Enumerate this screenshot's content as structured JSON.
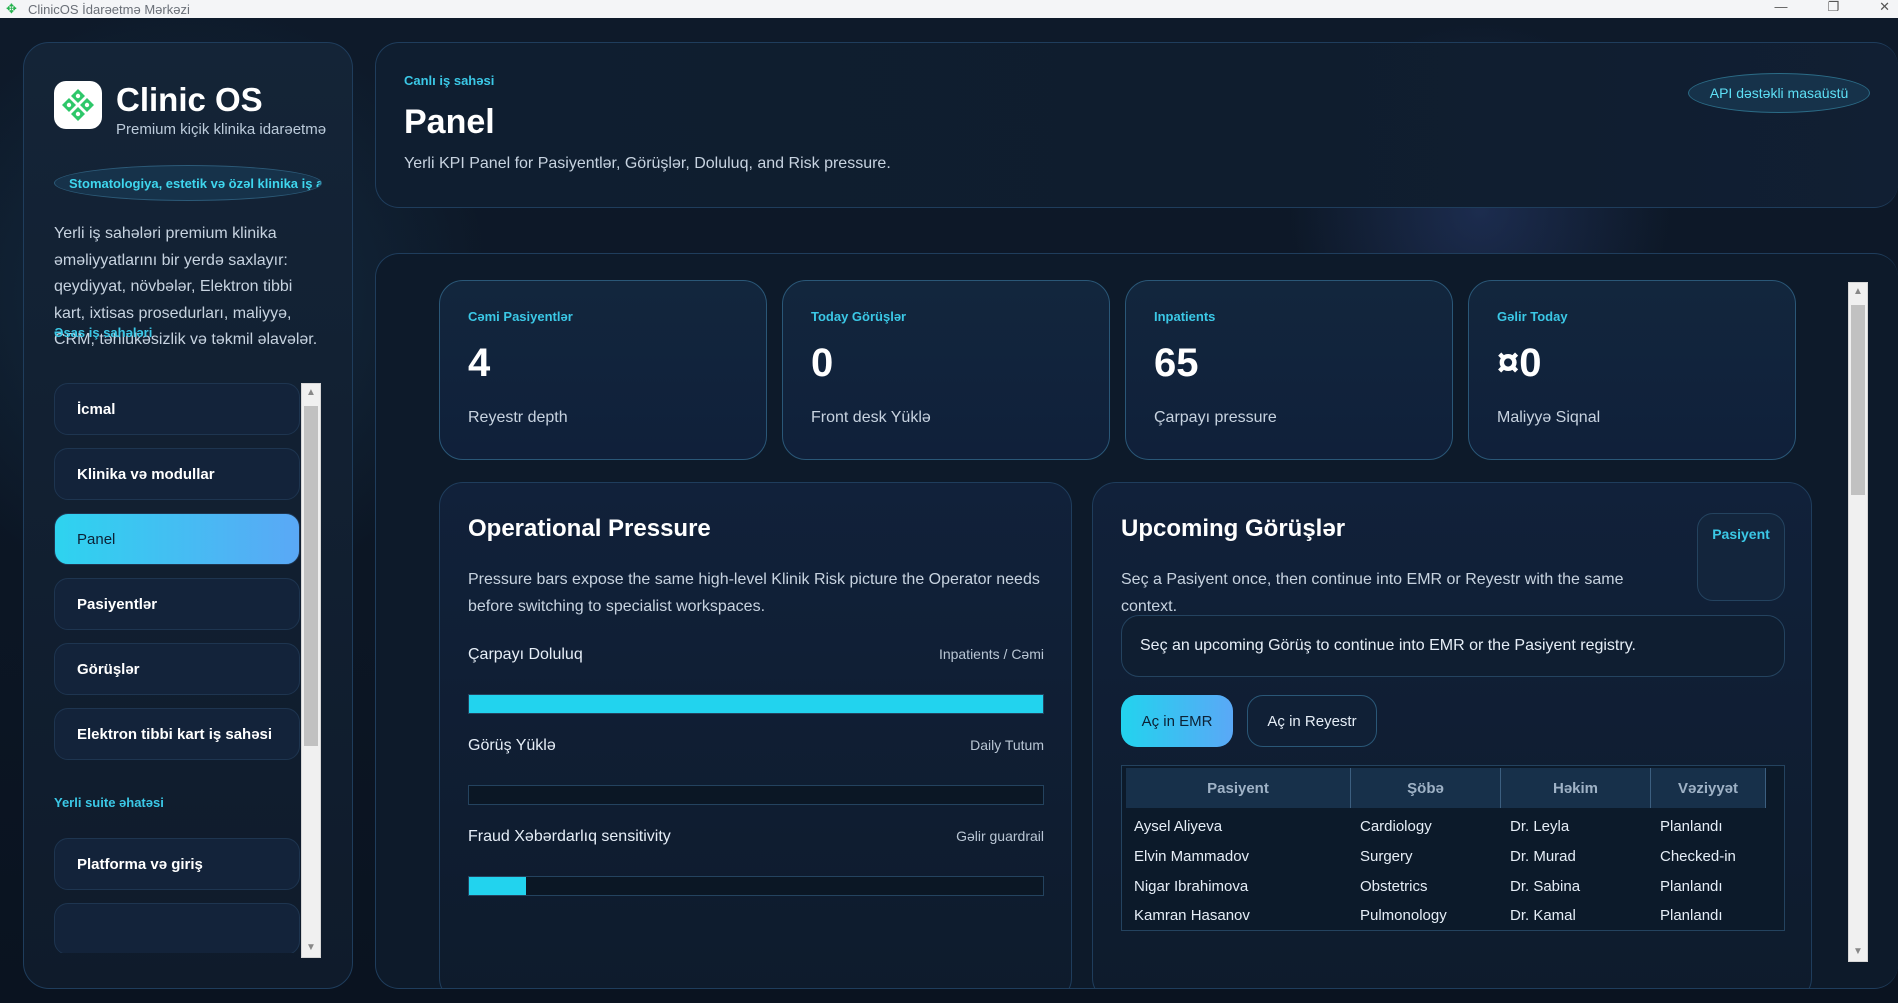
{
  "window": {
    "title": "ClinicOS İdarəetmə Mərkəzi"
  },
  "sidebar": {
    "brand_title": "Clinic OS",
    "brand_subtitle": "Premium kiçik klinika idarəetmə",
    "tag": "Stomatologiya, estetik və özəl klinika iş axını",
    "description": "Yerli iş sahələri premium klinika əməliyyatlarını bir yerdə saxlayır: qeydiyyat, növbələr, Elektron tibbi kart, ixtisas prosedurları, maliyyə, CRM, təhlükəsizlik və təkmil əlavələr.",
    "section_main": "Əsas iş sahələri",
    "section_suite": "Yerli suite əhatəsi",
    "items": [
      {
        "label": "İcmal"
      },
      {
        "label": "Klinika və modullar"
      },
      {
        "label": "Panel",
        "active": true
      },
      {
        "label": "Pasiyentlər"
      },
      {
        "label": "Görüşlər"
      },
      {
        "label": "Elektron tibbi kart iş sahəsi"
      }
    ],
    "suite_items": [
      {
        "label": "Platforma və giriş"
      }
    ]
  },
  "header": {
    "eyebrow": "Canlı iş sahəsi",
    "title": "Panel",
    "subtitle": "Yerli KPI Panel for Pasiyentlər, Görüşlər, Doluluq, and Risk pressure.",
    "api_badge": "API dəstəkli masaüstü"
  },
  "kpis": [
    {
      "label": "Cəmi Pasiyentlər",
      "value": "4",
      "hint": "Reyestr depth"
    },
    {
      "label": "Today Görüşlər",
      "value": "0",
      "hint": "Front desk Yüklə"
    },
    {
      "label": "Inpatients",
      "value": "65",
      "hint": "Çarpayı pressure"
    },
    {
      "label": "Gəlir Today",
      "value": "¤0",
      "hint": "Maliyyə Siqnal"
    }
  ],
  "pressure": {
    "title": "Operational Pressure",
    "description": "Pressure bars expose the same high-level Klinik Risk picture the Operator needs before switching to specialist workspaces.",
    "bars": [
      {
        "label": "Çarpayı Doluluq",
        "meta": "Inpatients / Cəmi",
        "fill": 1.0
      },
      {
        "label": "Görüş Yüklə",
        "meta": "Daily Tutum",
        "fill": 0.0
      },
      {
        "label": "Fraud Xəbərdarlıq sensitivity",
        "meta": "Gəlir guardrail",
        "fill": 0.1
      }
    ]
  },
  "upcoming": {
    "title": "Upcoming Görüşlər",
    "description": "Seç a Pasiyent once, then continue into EMR or Reyestr with the same context.",
    "chip": "Pasiyent",
    "hint": "Seç an upcoming Görüş to continue into EMR or the Pasiyent registry.",
    "btn_emr": "Aç in EMR",
    "btn_registry": "Aç in Reyestr",
    "columns": [
      "Pasiyent",
      "Şöbə",
      "Həkim",
      "Vəziyyət"
    ],
    "rows": [
      [
        "Aysel Aliyeva",
        "Cardiology",
        "Dr. Leyla",
        "Planlandı"
      ],
      [
        "Elvin Mammadov",
        "Surgery",
        "Dr. Murad",
        "Checked-in"
      ],
      [
        "Nigar Ibrahimova",
        "Obstetrics",
        "Dr. Sabina",
        "Planlandı"
      ],
      [
        "Kamran Hasanov",
        "Pulmonology",
        "Dr. Kamal",
        "Planlandı"
      ]
    ]
  },
  "colors": {
    "accent": "#22d3ee",
    "accent_secondary": "#5aa8f6",
    "panel_border": "#1f3d5c",
    "background": "#0c1624"
  }
}
